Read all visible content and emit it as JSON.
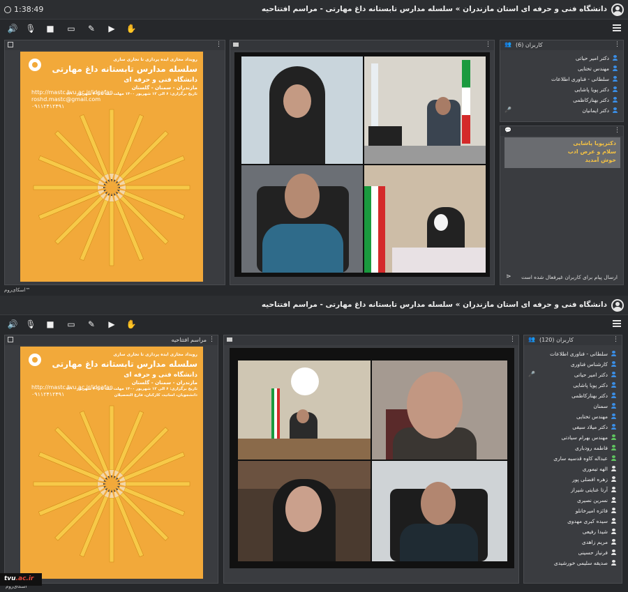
{
  "session1": {
    "clock": "1:38:49",
    "breadcrumb": "دانشگاه فنی و حرفه ای استان مازندران » سلسله مدارس تابستانه داغ مهارتی - مراسم افتتاحیه",
    "users_title": "کاربران (6)",
    "users": [
      {
        "name": "دکتر امیر حیاتی",
        "color": "#3a8ee6",
        "mic": false
      },
      {
        "name": "مهندس تختایی",
        "color": "#3a8ee6",
        "mic": false
      },
      {
        "name": "سلطانی - فناوری اطلاعات",
        "color": "#3a8ee6",
        "mic": false
      },
      {
        "name": "دکتر پویا پاشایی",
        "color": "#3a8ee6",
        "mic": false
      },
      {
        "name": "دکتر بهنازکاظمی",
        "color": "#3a8ee6",
        "mic": false
      },
      {
        "name": "دکتر ایمانیان",
        "color": "#3a8ee6",
        "mic": true
      }
    ],
    "chat_messages": [
      "دکترپویا پاشایی",
      "سلام و عرض ادب",
      "خوش آمدید"
    ],
    "chat_placeholder": "ارسال پیام برای کاربران غیرفعال شده است",
    "watermark": "اسکای‌روم™"
  },
  "session2": {
    "breadcrumb": "دانشگاه فنی و حرفه ای استان مازندران » سلسله مدارس تابستانه داغ مهارتی - مراسم افتتاحیه",
    "presentation_title": "مراسم افتتاحیه",
    "users_title": "کاربران (120)",
    "users": [
      {
        "name": "سلطانی - فناوری اطلاعات",
        "color": "#3a8ee6",
        "mic": false
      },
      {
        "name": "کارشناس فناوری",
        "color": "#3a8ee6",
        "mic": false
      },
      {
        "name": "دکتر امیر حیاتی",
        "color": "#3a8ee6",
        "mic": true
      },
      {
        "name": "دکتر پویا پاشایی",
        "color": "#3a8ee6",
        "mic": false
      },
      {
        "name": "دکتر بهنازکاظمی",
        "color": "#3a8ee6",
        "mic": false
      },
      {
        "name": "سمنان",
        "color": "#3a8ee6",
        "mic": false
      },
      {
        "name": "مهندس تختایی",
        "color": "#3a8ee6",
        "mic": false
      },
      {
        "name": "دکتر میلاد سیفی",
        "color": "#3a8ee6",
        "mic": false
      },
      {
        "name": "مهندس بهرام سیادتی",
        "color": "#5fc45f",
        "mic": false
      },
      {
        "name": "فاطمه رودباری",
        "color": "#5fc45f",
        "mic": false
      },
      {
        "name": "عبداله کاوه قدسیه ساری",
        "color": "#5fc45f",
        "mic": false
      },
      {
        "name": "الهه تیموری",
        "color": "#e6e6e6",
        "mic": false
      },
      {
        "name": "زهره افضلی پور",
        "color": "#e6e6e6",
        "mic": false
      },
      {
        "name": "آرتا عنایتی شیراز",
        "color": "#e6e6e6",
        "mic": false
      },
      {
        "name": "نسرین نصیری",
        "color": "#e6e6e6",
        "mic": false
      },
      {
        "name": "فائزه امیرخانلو",
        "color": "#e6e6e6",
        "mic": false
      },
      {
        "name": "سیده کبری مهدوی",
        "color": "#e6e6e6",
        "mic": false
      },
      {
        "name": "شیدا رفیعی",
        "color": "#e6e6e6",
        "mic": false
      },
      {
        "name": "مریم زاهدی",
        "color": "#e6e6e6",
        "mic": false
      },
      {
        "name": "فرنیاز حسینی",
        "color": "#e6e6e6",
        "mic": false
      },
      {
        "name": "صدیقه سلیمی خورشیدی",
        "color": "#e6e6e6",
        "mic": false
      }
    ],
    "watermark": "اسکای‌روم™"
  },
  "poster": {
    "top_line": "رویداد مجازی ایده پردازی تا تجاری سازی",
    "title": "سلسله مدارس تابستانه داغ مهارتی",
    "subtitle": "دانشگاه فنی و حرفه ای",
    "provinces": "مازندران - سمنان - گلستان",
    "dates": "تاریخ برگزاری: ۶ الی ۱۲ شهریور ۱۴۰۰ مهلت ثبت نام: ۴ شهریور ۱۴۰۰",
    "audience": "دانشجویان، اساتید، کارکنان، فارغ التحصیلان",
    "register": "ثبت نام رایگان",
    "url": "http://mastc.tvu.ac.ir/ideafan",
    "email": "roshd.mastc@gmail.com",
    "phone": "۰۹۱۱۲۴۱۲۴۹۱",
    "accent_color": "#f2a93a"
  },
  "toolbar": {
    "icons": [
      "speaker-icon",
      "mic-muted-icon",
      "camera-icon",
      "screen-share-icon",
      "brush-icon",
      "play-media-icon",
      "raise-hand-icon"
    ]
  },
  "footer_logo": {
    "prefix": "tvu",
    "suffix": ".ac.ir"
  }
}
